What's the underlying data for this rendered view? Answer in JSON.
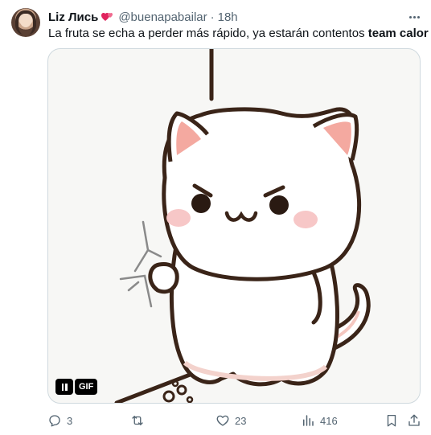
{
  "post": {
    "author_name": "Liz Лись",
    "handle": "@buenapabailar",
    "separator": "·",
    "time": "18h",
    "text_main": "La fruta se echa a perder más  rápido,  ya estarán contentos ",
    "text_bold": "team calor"
  },
  "media": {
    "type": "gif",
    "gif_badge": "GIF",
    "description_icon": "cat-gif"
  },
  "actions": {
    "replies": "3",
    "reposts": "",
    "likes": "23",
    "views": "416"
  },
  "colors": {
    "text": "#0f1419",
    "secondary": "#536471",
    "border": "#cfd9de",
    "heart": "#e0245e"
  }
}
